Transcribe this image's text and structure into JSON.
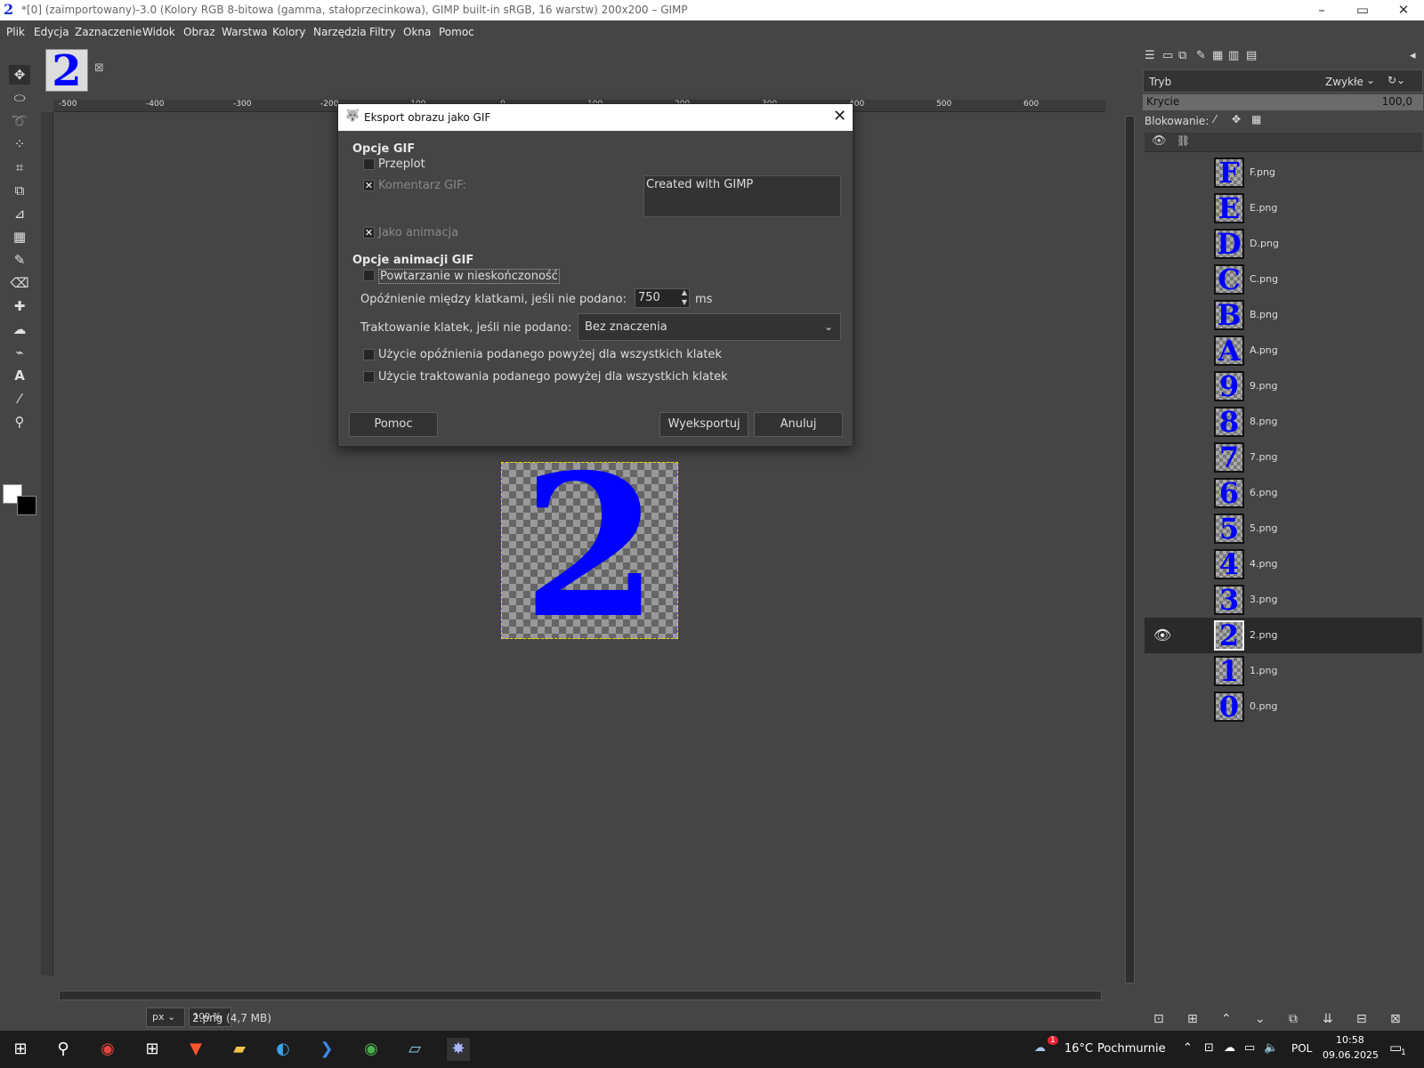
{
  "window": {
    "title": "*[0] (zaimportowany)-3.0 (Kolory RGB 8-bitowa (gamma, stałoprzecinkowa), GIMP built-in sRGB, 16 warstw) 200x200 – GIMP",
    "minimize": "–",
    "maximize": "▭",
    "close": "✕"
  },
  "menu": [
    "Plik",
    "Edycja",
    "Zaznaczenie",
    "Widok",
    "Obraz",
    "Warstwa",
    "Kolory",
    "Narzędzia",
    "Filtry",
    "Okna",
    "Pomoc"
  ],
  "image_tab": {
    "thumb_glyph": "2",
    "close": "⊠"
  },
  "ruler": {
    "h_ticks": [
      "-500",
      "-400",
      "-300",
      "-200",
      "-100",
      "0",
      "100",
      "200",
      "300",
      "400",
      "500",
      "600"
    ]
  },
  "canvas": {
    "glyph": "2",
    "fill_color": "#0000ff"
  },
  "status": {
    "unit": "px",
    "zoom": "100 %",
    "file_info": "2.png (4,7 MB)"
  },
  "dock": {
    "mode_label": "Tryb",
    "mode_value": "Zwykłe",
    "opacity_label": "Krycie",
    "opacity_value": "100,0",
    "lock_label": "Blokowanie:"
  },
  "layers": [
    {
      "glyph": "F",
      "name": "F.png"
    },
    {
      "glyph": "E",
      "name": "E.png"
    },
    {
      "glyph": "D",
      "name": "D.png"
    },
    {
      "glyph": "C",
      "name": "C.png"
    },
    {
      "glyph": "B",
      "name": "B.png"
    },
    {
      "glyph": "A",
      "name": "A.png"
    },
    {
      "glyph": "9",
      "name": "9.png"
    },
    {
      "glyph": "8",
      "name": "8.png"
    },
    {
      "glyph": "7",
      "name": "7.png"
    },
    {
      "glyph": "6",
      "name": "6.png"
    },
    {
      "glyph": "5",
      "name": "5.png"
    },
    {
      "glyph": "4",
      "name": "4.png"
    },
    {
      "glyph": "3",
      "name": "3.png"
    },
    {
      "glyph": "2",
      "name": "2.png",
      "selected": true,
      "visible": true
    },
    {
      "glyph": "1",
      "name": "1.png"
    },
    {
      "glyph": "0",
      "name": "0.png"
    }
  ],
  "dialog": {
    "title": "Eksport obrazu jako GIF",
    "section_gif": "Opcje GIF",
    "interlace": "Przeplot",
    "interlace_checked": false,
    "comment_label": "Komentarz GIF:",
    "comment_checked": true,
    "comment_value": "Created with GIMP",
    "as_animation": "Jako animacja",
    "as_animation_checked": true,
    "section_anim": "Opcje animacji GIF",
    "loop": "Powtarzanie w nieskończoność",
    "loop_checked": false,
    "delay_label": "Opóźnienie między klatkami, jeśli nie podano:",
    "delay_value": "750",
    "delay_unit": "ms",
    "disposal_label": "Traktowanie klatek, jeśli nie podano:",
    "disposal_value": "Bez znaczenia",
    "use_delay_all": "Użycie opóźnienia podanego powyżej dla wszystkich klatek",
    "use_disposal_all": "Użycie traktowania podanego powyżej dla wszystkich klatek",
    "help_button": "Pomoc",
    "export_button": "Wyeksportuj",
    "cancel_button": "Anuluj"
  },
  "taskbar": {
    "weather_temp": "16°C",
    "weather_text": "Pochmurnie",
    "weather_badge": "1",
    "language": "POL",
    "time": "10:58",
    "date": "09.06.2025",
    "notif_count": "1"
  }
}
